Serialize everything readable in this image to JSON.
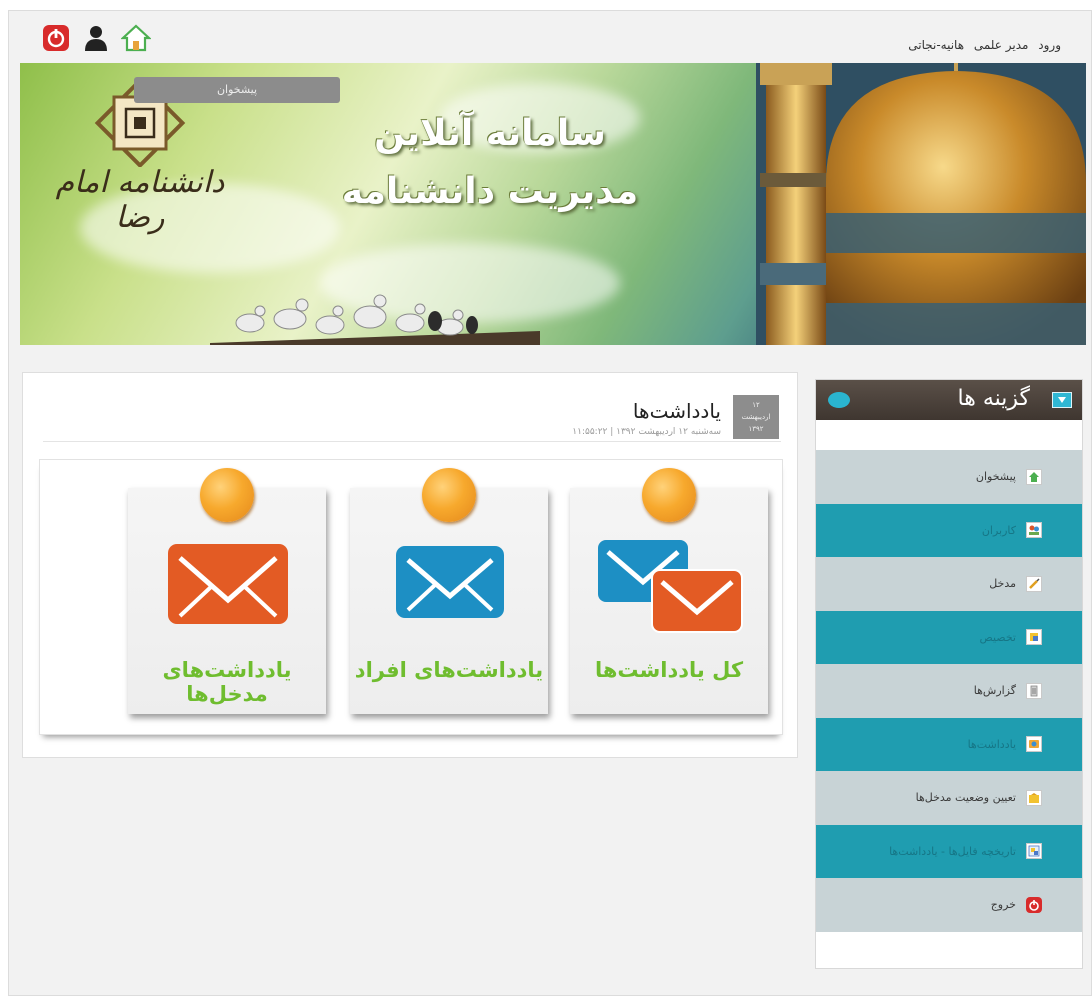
{
  "header": {
    "login_label": "ورود",
    "role": "مدیر علمی",
    "user": "هانیه-نجاتی",
    "icons": [
      "power-icon",
      "user-icon",
      "home-icon"
    ]
  },
  "banner": {
    "tooltip": "پیشخوان",
    "title_line1": "سامانه آنلاین",
    "title_line2": "مدیریت دانشنامه",
    "logo_text": "دانشنامه امام رضا"
  },
  "post": {
    "title": "یادداشت‌ها",
    "meta": "سه‌شنبه ۱۲ اردیبهشت ۱۳۹۲ | ۱۱:۵۵:۲۲",
    "date_box": [
      "۱۲",
      "اردیبهشت",
      "۱۳۹۲"
    ]
  },
  "cards": [
    {
      "label": "کل یادداشت‌ها",
      "icon": "envelopes-icon"
    },
    {
      "label": "یادداشت‌های افراد",
      "icon": "envelope-blue-icon"
    },
    {
      "label": "یادداشت‌های مدخل‌ها",
      "icon": "envelope-orange-icon"
    }
  ],
  "sidebar": {
    "title": "گزینه ها",
    "items": [
      {
        "label": "پیشخوان",
        "style": "light",
        "icon": "dashboard-icon"
      },
      {
        "label": "کاربران",
        "style": "teal",
        "icon": "users-icon"
      },
      {
        "label": "مدخل",
        "style": "light",
        "icon": "entry-icon"
      },
      {
        "label": "تخصیص",
        "style": "teal",
        "icon": "assign-icon"
      },
      {
        "label": "گزارش‌ها",
        "style": "light",
        "icon": "report-icon"
      },
      {
        "label": "یادداشت‌ها",
        "style": "teal",
        "icon": "notes-icon"
      },
      {
        "label": "تعیین وضعیت مدخل‌ها",
        "style": "light",
        "icon": "status-icon"
      },
      {
        "label": "تاریخچه فایل‌ها - یادداشت‌ها",
        "style": "teal",
        "icon": "history-icon"
      },
      {
        "label": "خروج",
        "style": "light",
        "icon": "logout-icon"
      }
    ]
  },
  "colors": {
    "teal": "#1f9db0",
    "light_item": "#c8d3d6",
    "card_label": "#6fbd2f",
    "pin": "#f7a92d",
    "envelope_blue": "#1d8fc4",
    "envelope_orange": "#e35b24"
  }
}
